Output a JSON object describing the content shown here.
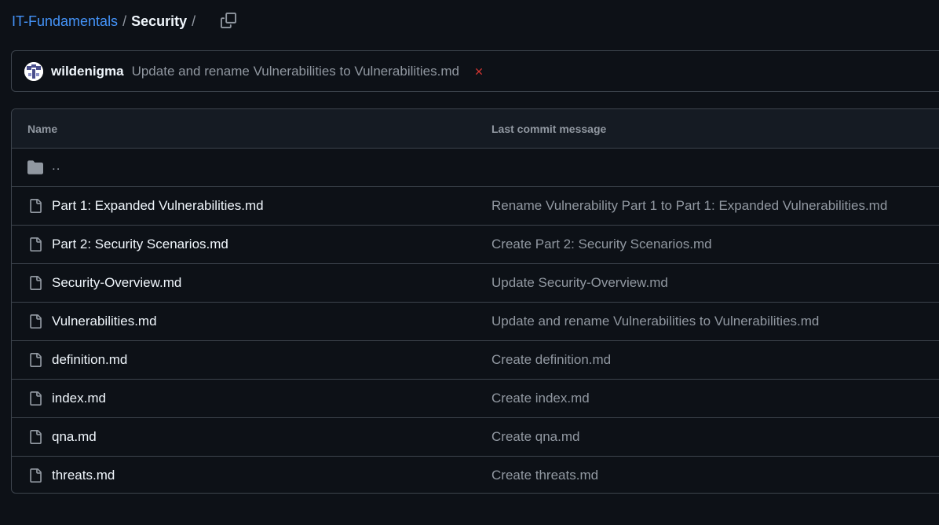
{
  "breadcrumb": {
    "repo": "IT-Fundamentals",
    "separator": "/",
    "current": "Security",
    "trailing_separator": "/"
  },
  "copy_path_icon": "copy-icon",
  "latest_commit": {
    "author": "wildenigma",
    "message": "Update and rename Vulnerabilities to Vulnerabilities.md",
    "status_icon": "x-icon",
    "status_color": "#da3633"
  },
  "table": {
    "columns": [
      "Name",
      "Last commit message"
    ],
    "parent_dir": "..",
    "files": [
      {
        "name": "Part 1: Expanded Vulnerabilities.md",
        "commit": "Rename Vulnerability Part 1 to Part 1: Expanded Vulnerabilities.md",
        "icon": "file-icon"
      },
      {
        "name": "Part 2: Security Scenarios.md",
        "commit": "Create Part 2: Security Scenarios.md",
        "icon": "file-icon"
      },
      {
        "name": "Security-Overview.md",
        "commit": "Update Security-Overview.md",
        "icon": "file-icon"
      },
      {
        "name": "Vulnerabilities.md",
        "commit": "Update and rename Vulnerabilities to Vulnerabilities.md",
        "icon": "file-icon"
      },
      {
        "name": "definition.md",
        "commit": "Create definition.md",
        "icon": "file-icon"
      },
      {
        "name": "index.md",
        "commit": "Create index.md",
        "icon": "file-icon"
      },
      {
        "name": "qna.md",
        "commit": "Create qna.md",
        "icon": "file-icon"
      },
      {
        "name": "threats.md",
        "commit": "Create threats.md",
        "icon": "file-icon"
      }
    ]
  },
  "colors": {
    "background": "#0d1117",
    "link": "#4493f8",
    "muted": "#9198a1",
    "border": "#3d444d"
  }
}
